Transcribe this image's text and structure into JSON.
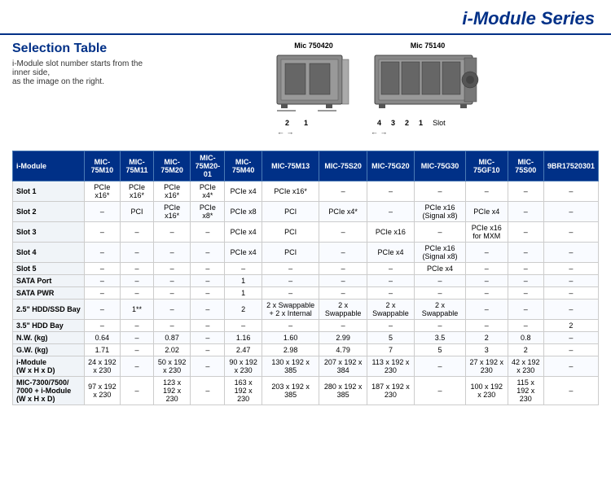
{
  "header": {
    "title": "i-Module Series"
  },
  "section": {
    "title": "Selection Table",
    "subtitle_line1": "i-Module slot number starts from the inner side,",
    "subtitle_line2": "as the image on the right."
  },
  "devices": [
    {
      "label": "Mic 750420",
      "slots": [
        "2",
        "1"
      ]
    },
    {
      "label": "Mic 75140",
      "slots": [
        "4",
        "3",
        "2",
        "1"
      ],
      "slot_text": "Slot"
    }
  ],
  "table": {
    "columns": [
      "i-Module",
      "MIC-75M10",
      "MIC-75M11",
      "MIC-75M20",
      "MIC-75M20-01",
      "MIC-75M40",
      "MIC-75M13",
      "MIC-75S20",
      "MIC-75G20",
      "MIC-75G30",
      "MIC-75GF10",
      "MIC-75S00",
      "9BR17520301"
    ],
    "rows": [
      {
        "header": "Slot 1",
        "cells": [
          "PCIe x16*",
          "PCIe x16*",
          "PCIe x16*",
          "PCIe x4*",
          "PCIe x4",
          "PCIe x16*",
          "–",
          "–",
          "–",
          "–",
          "–",
          "–"
        ]
      },
      {
        "header": "Slot 2",
        "cells": [
          "–",
          "PCI",
          "PCIe x16*",
          "PCIe x8*",
          "PCIe x8",
          "PCI",
          "PCIe x4*",
          "–",
          "PCIe x16 (Signal x8)",
          "PCIe x4",
          "–",
          "–"
        ]
      },
      {
        "header": "Slot 3",
        "cells": [
          "–",
          "–",
          "–",
          "–",
          "PCIe x4",
          "PCI",
          "–",
          "PCIe x16",
          "–",
          "PCIe x16 for MXM",
          "–",
          "–"
        ]
      },
      {
        "header": "Slot 4",
        "cells": [
          "–",
          "–",
          "–",
          "–",
          "PCIe x4",
          "PCI",
          "–",
          "PCIe x4",
          "PCIe x16 (Signal x8)",
          "–",
          "–",
          "–"
        ]
      },
      {
        "header": "Slot 5",
        "cells": [
          "–",
          "–",
          "–",
          "–",
          "–",
          "–",
          "–",
          "–",
          "PCIe x4",
          "–",
          "–",
          "–"
        ]
      },
      {
        "header": "SATA Port",
        "cells": [
          "–",
          "–",
          "–",
          "–",
          "1",
          "–",
          "–",
          "–",
          "–",
          "–",
          "–",
          "–"
        ]
      },
      {
        "header": "SATA PWR",
        "cells": [
          "–",
          "–",
          "–",
          "–",
          "1",
          "–",
          "–",
          "–",
          "–",
          "–",
          "–",
          "–"
        ]
      },
      {
        "header": "2.5\" HDD/SSD Bay",
        "cells": [
          "–",
          "1**",
          "–",
          "–",
          "2",
          "2 x Swappable + 2 x Internal",
          "2 x Swappable",
          "2 x Swappable",
          "2 x Swappable",
          "–",
          "–",
          "–"
        ]
      },
      {
        "header": "3.5\" HDD Bay",
        "cells": [
          "–",
          "–",
          "–",
          "–",
          "–",
          "–",
          "–",
          "–",
          "–",
          "–",
          "–",
          "2"
        ]
      },
      {
        "header": "N.W. (kg)",
        "cells": [
          "0.64",
          "–",
          "0.87",
          "–",
          "1.16",
          "1.60",
          "2.99",
          "5",
          "3.5",
          "2",
          "0.8"
        ]
      },
      {
        "header": "G.W. (kg)",
        "cells": [
          "1.71",
          "–",
          "2.02",
          "–",
          "2.47",
          "2.98",
          "4.79",
          "7",
          "5",
          "3",
          "2"
        ]
      },
      {
        "header": "i-Module (W x H x D)",
        "cells": [
          "24 x 192 x 230",
          "–",
          "50 x 192 x 230",
          "–",
          "90 x 192 x 230",
          "130 x 192 x 385",
          "207 x 192 x 384",
          "113 x 192 x 230",
          "27 x 192 x 230",
          "42 x 192 x 230"
        ]
      },
      {
        "header": "MIC-7300/7500/7000 + i-Module (W x H x D)",
        "cells": [
          "97 x 192 x 230",
          "–",
          "123 x 192 x 230",
          "–",
          "163 x 192 x 230",
          "203 x 192 x 385",
          "280 x 192 x 385",
          "187 x 192 x 230",
          "100 x 192 x 230",
          "115 x 192 x 230"
        ]
      }
    ]
  }
}
